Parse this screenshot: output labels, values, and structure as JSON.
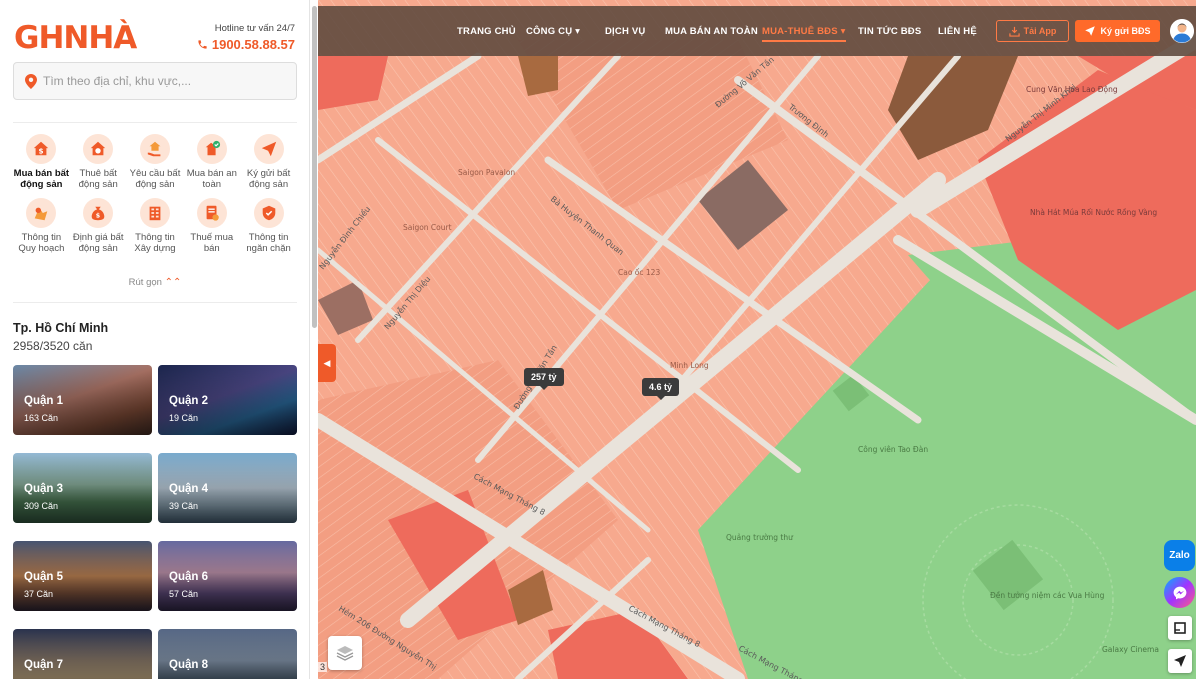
{
  "brand": {
    "logo_text": "GHNHÀ",
    "accent": "#ef5a29"
  },
  "hotline": {
    "label": "Hotline tư vấn 24/7",
    "number": "1900.58.88.57"
  },
  "search": {
    "placeholder": "Tìm theo địa chỉ, khu vực,..."
  },
  "services": [
    {
      "label": "Mua bán bất động sản",
      "icon": "house-dollar-icon",
      "active": true
    },
    {
      "label": "Thuê bất động sản",
      "icon": "house-search-icon",
      "active": false
    },
    {
      "label": "Yêu cầu bất động sản",
      "icon": "hand-house-icon",
      "active": false
    },
    {
      "label": "Mua bán an toàn",
      "icon": "safe-deal-icon",
      "active": false
    },
    {
      "label": "Ký gửi bất động sản",
      "icon": "paper-plane-icon",
      "active": false
    },
    {
      "label": "Thông tin Quy hoạch",
      "icon": "map-pin-icon",
      "active": false
    },
    {
      "label": "Định giá bất động sản",
      "icon": "money-bag-icon",
      "active": false
    },
    {
      "label": "Thông tin Xây dựng",
      "icon": "building-icon",
      "active": false
    },
    {
      "label": "Thuế mua bán",
      "icon": "tax-document-icon",
      "active": false
    },
    {
      "label": "Thông tin ngăn chặn",
      "icon": "shield-check-icon",
      "active": false
    }
  ],
  "collapse_label": "Rút gọn",
  "region": {
    "city": "Tp. Hồ Chí Minh",
    "count": "2958/3520 căn"
  },
  "districts": [
    {
      "name": "Quận 1",
      "count": "163 Căn"
    },
    {
      "name": "Quận 2",
      "count": "19 Căn"
    },
    {
      "name": "Quận 3",
      "count": "309 Căn"
    },
    {
      "name": "Quận 4",
      "count": "39 Căn"
    },
    {
      "name": "Quận 5",
      "count": "37 Căn"
    },
    {
      "name": "Quận 6",
      "count": "57 Căn"
    },
    {
      "name": "Quận 7",
      "count": ""
    },
    {
      "name": "Quận 8",
      "count": ""
    }
  ],
  "nav": {
    "items": [
      {
        "label": "TRANG CHỦ",
        "active": false,
        "dropdown": false
      },
      {
        "label": "CÔNG CỤ",
        "active": false,
        "dropdown": true
      },
      {
        "label": "DỊCH VỤ",
        "active": false,
        "dropdown": false
      },
      {
        "label": "MUA BÁN AN TOÀN",
        "active": false,
        "dropdown": false
      },
      {
        "label": "MUA-THUÊ BĐS",
        "active": true,
        "dropdown": true
      },
      {
        "label": "TIN TỨC BĐS",
        "active": false,
        "dropdown": false
      },
      {
        "label": "LIÊN HỆ",
        "active": false,
        "dropdown": false
      }
    ],
    "app_button": "Tải App",
    "post_button": "Ký gửi BĐS"
  },
  "map": {
    "price_markers": [
      "257 tỷ",
      "4.6 tỷ"
    ],
    "street_labels": [
      "Đường Võ Văn Tần",
      "Trương Định",
      "Nguyễn Thị Minh Khai",
      "Bà Huyện Thanh Quan",
      "Nguyễn Thị Diệu",
      "Cách Mạng Tháng 8",
      "Đường Võ Văn Tần",
      "Nguyễn Đình Chiểu",
      "Hẻm 206 Đường Nguyễn Thị",
      "Cách Mạng Tháng 8",
      "Cách Mạng Tháng 8"
    ],
    "poi_labels": [
      "Saigon Pavalon",
      "Saigon Court",
      "Cao ốc 123",
      "Minh Long",
      "Đền tưởng niệm các Vua Hùng",
      "Galaxy Cinema",
      "Cung Văn Hóa Lao Động",
      "Nhà Hát Múa Rối Nước Rồng Vàng",
      "Công viên Tao Đàn",
      "Quảng trường thư"
    ],
    "scale_fragment": "3",
    "zone_colors": {
      "residential": "#f7a98e",
      "commercial": "#ee6b5c",
      "park": "#8ed18a",
      "institutional": "#8b5a3c"
    }
  },
  "side_tools": [
    "Zalo",
    "messenger-icon",
    "measure-icon",
    "locate-icon"
  ]
}
